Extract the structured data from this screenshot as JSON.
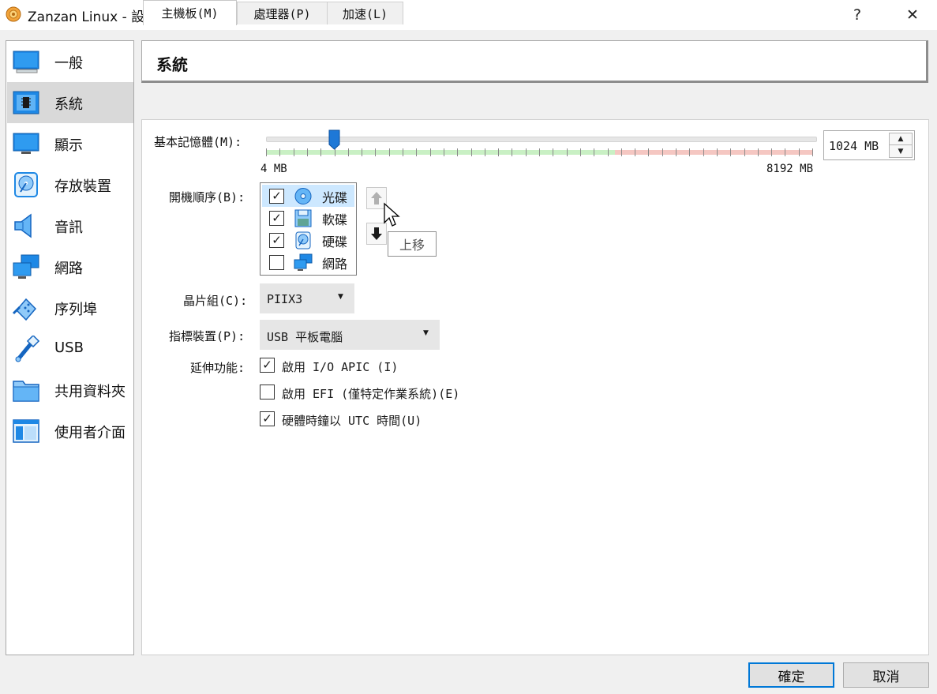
{
  "window": {
    "title": "Zanzan Linux - 設定",
    "help_label": "?",
    "close_label": "✕"
  },
  "sidebar": {
    "items": [
      {
        "label": "一般",
        "icon": "general-icon"
      },
      {
        "label": "系統",
        "icon": "system-icon",
        "active": true
      },
      {
        "label": "顯示",
        "icon": "display-icon"
      },
      {
        "label": "存放裝置",
        "icon": "storage-icon"
      },
      {
        "label": "音訊",
        "icon": "audio-icon"
      },
      {
        "label": "網路",
        "icon": "network-icon"
      },
      {
        "label": "序列埠",
        "icon": "serial-port-icon"
      },
      {
        "label": "USB",
        "icon": "usb-icon"
      },
      {
        "label": "共用資料夾",
        "icon": "shared-folder-icon"
      },
      {
        "label": "使用者介面",
        "icon": "user-interface-icon"
      }
    ]
  },
  "header": {
    "title": "系統"
  },
  "tabs": [
    {
      "label": "主機板(M)",
      "active": true
    },
    {
      "label": "處理器(P)"
    },
    {
      "label": "加速(L)"
    }
  ],
  "motherboard": {
    "memory_label": "基本記憶體(M):",
    "memory_min": "4 MB",
    "memory_max": "8192 MB",
    "memory_value": "1024 MB",
    "memory_value_mb": 1024,
    "memory_range_mb": [
      4,
      8192
    ],
    "boot_order_label": "開機順序(B):",
    "boot_order": [
      {
        "label": "光碟",
        "checked": true,
        "icon": "optical-disc-icon",
        "selected": true
      },
      {
        "label": "軟碟",
        "checked": true,
        "icon": "floppy-icon"
      },
      {
        "label": "硬碟",
        "checked": true,
        "icon": "hard-disk-icon"
      },
      {
        "label": "網路",
        "checked": false,
        "icon": "network-icon"
      }
    ],
    "move_up_tooltip": "上移",
    "chipset_label": "晶片組(C):",
    "chipset_value": "PIIX3",
    "pointing_label": "指標裝置(P):",
    "pointing_value": "USB 平板電腦",
    "extended_label": "延伸功能:",
    "extended_options": [
      {
        "label": "啟用 I/O APIC (I)",
        "checked": true
      },
      {
        "label": "啟用 EFI (僅特定作業系統)(E)",
        "checked": false
      },
      {
        "label": "硬體時鐘以 UTC 時間(U)",
        "checked": true
      }
    ]
  },
  "footer": {
    "ok_label": "確定",
    "cancel_label": "取消"
  },
  "colors": {
    "accent": "#0078d7",
    "selected_row": "#cde8ff",
    "sidebar_active": "#d9d9d9",
    "scale_green": "#c9f0c4",
    "scale_red": "#f5c7c2"
  }
}
